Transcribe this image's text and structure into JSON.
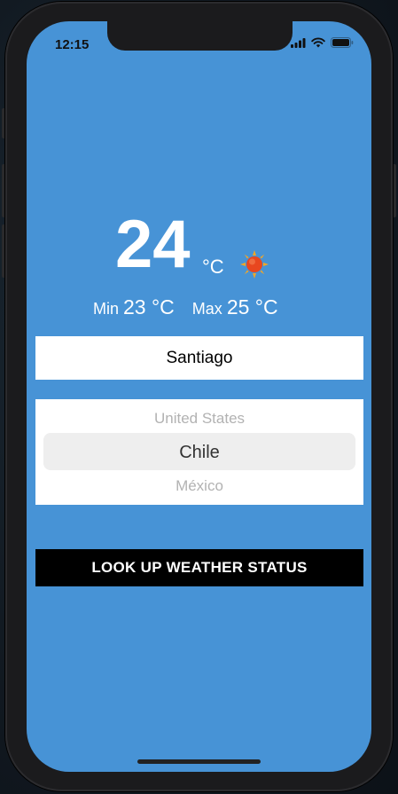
{
  "status_bar": {
    "time": "12:15"
  },
  "weather": {
    "temperature": "24",
    "unit": "°C",
    "min_label": "Min",
    "min_value": "23 °C",
    "max_label": "Max",
    "max_value": "25 °C",
    "condition_icon": "sun-icon"
  },
  "city_input": {
    "value": "Santiago"
  },
  "country_picker": {
    "items": [
      "United States",
      "Chile",
      "México"
    ],
    "selected": "Chile"
  },
  "lookup_button": {
    "label": "LOOK UP WEATHER STATUS"
  },
  "colors": {
    "background": "#4793d6",
    "button": "#000000",
    "sun": "#f5a623"
  }
}
